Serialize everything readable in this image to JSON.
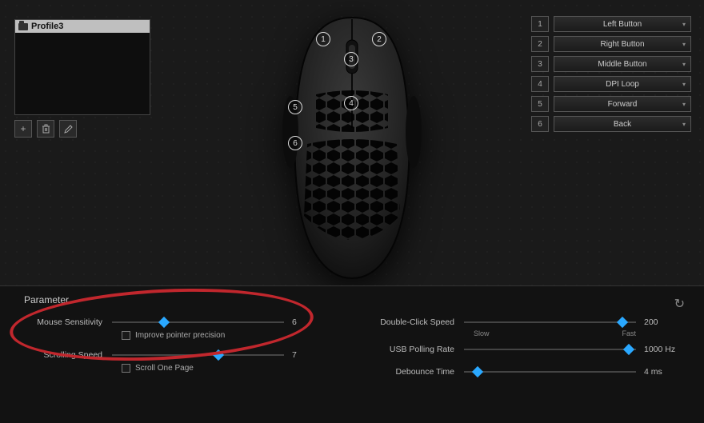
{
  "profile": {
    "selected": "Profile3"
  },
  "buttons": [
    {
      "num": "1",
      "label": "Left Button"
    },
    {
      "num": "2",
      "label": "Right Button"
    },
    {
      "num": "3",
      "label": "Middle Button"
    },
    {
      "num": "4",
      "label": "DPI Loop"
    },
    {
      "num": "5",
      "label": "Forward"
    },
    {
      "num": "6",
      "label": "Back"
    }
  ],
  "panel": {
    "title": "Parameter",
    "mouse_sensitivity": {
      "label": "Mouse Sensitivity",
      "value": "6",
      "pct": 30
    },
    "improve_precision": {
      "label": "Improve pointer precision"
    },
    "scrolling_speed": {
      "label": "Scrolling Speed",
      "value": "7",
      "pct": 62
    },
    "scroll_one_page": {
      "label": "Scroll One Page"
    },
    "double_click": {
      "label": "Double-Click Speed",
      "value": "200",
      "pct": 92,
      "low": "Slow",
      "high": "Fast"
    },
    "polling_rate": {
      "label": "USB Polling Rate",
      "value": "1000 Hz",
      "pct": 96
    },
    "debounce": {
      "label": "Debounce Time",
      "value": "4 ms",
      "pct": 8
    }
  }
}
